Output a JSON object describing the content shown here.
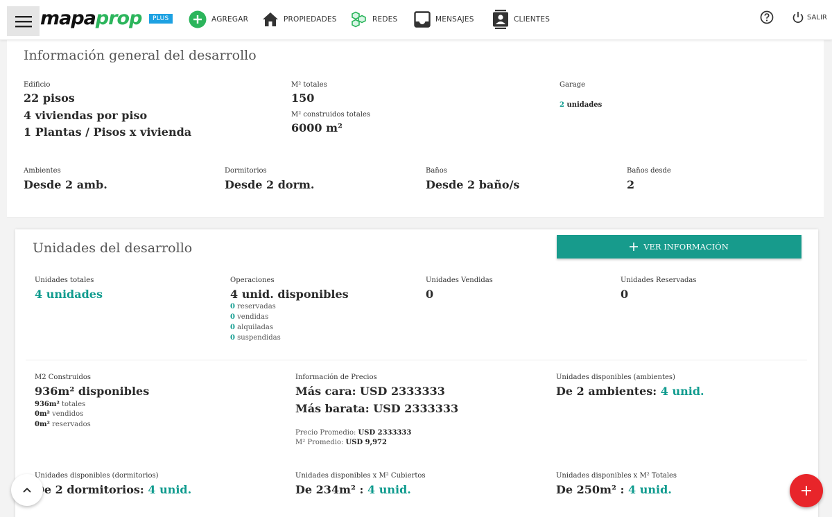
{
  "header": {
    "logo_a": "mapa",
    "logo_b": "prop",
    "plan_badge": "PLUS",
    "nav": [
      {
        "label": "AGREGAR",
        "icon": "add-circle-icon"
      },
      {
        "label": "PROPIEDADES",
        "icon": "home-icon"
      },
      {
        "label": "REDES",
        "icon": "network-icon"
      },
      {
        "label": "MENSAJES",
        "icon": "inbox-icon"
      },
      {
        "label": "CLIENTES",
        "icon": "contacts-icon"
      }
    ],
    "help_icon": "help-icon",
    "exit_label": "SALIR",
    "exit_icon": "power-icon"
  },
  "general": {
    "title": "Información general del desarrollo",
    "edificio_label": "Edificio",
    "edificio_lines": [
      "22 pisos",
      "4 viviendas por piso",
      "1 Plantas / Pisos x vivienda"
    ],
    "m2_totales_label": "M² totales",
    "m2_totales_value": "150",
    "m2_construidos_label": "M² construidos totales",
    "m2_construidos_value": "6000 m²",
    "garage_label": "Garage",
    "garage_count": "2",
    "garage_unit": "unidades",
    "ambientes_label": "Ambientes",
    "ambientes_value": "Desde 2 amb.",
    "dormitorios_label": "Dormitorios",
    "dormitorios_value": "Desde 2 dorm.",
    "banos_label": "Baños",
    "banos_value": "Desde 2 baño/s",
    "banos_desde_label": "Baños desde",
    "banos_desde_value": "2"
  },
  "units": {
    "title": "Unidades del desarrollo",
    "ver_button": "VER INFORMACIÓN",
    "totales_label": "Unidades totales",
    "totales_value": "4 unidades",
    "operaciones_label": "Operaciones",
    "operaciones_value": "4 unid. disponibles",
    "operaciones_breakdown": [
      {
        "count": "0",
        "label": "reservadas"
      },
      {
        "count": "0",
        "label": "vendidas"
      },
      {
        "count": "0",
        "label": "alquiladas"
      },
      {
        "count": "0",
        "label": "suspendidas"
      }
    ],
    "vendidas_label": "Unidades Vendidas",
    "vendidas_value": "0",
    "reservadas_label": "Unidades Reservadas",
    "reservadas_value": "0",
    "m2_label": "M2 Construidos",
    "m2_value": "936m² disponibles",
    "m2_totales": "936m²",
    "m2_totales_suffix": "totales",
    "m2_vendidos": "0m²",
    "m2_vendidos_suffix": "vendidos",
    "m2_reservados": "0m²",
    "m2_reservados_suffix": "reservados",
    "precios_label": "Información de Precios",
    "precio_cara": "Más cara: USD 2333333",
    "precio_barata": "Más barata: USD 2333333",
    "precio_promedio_label": "Precio Promedio:",
    "precio_promedio_value": "USD 2333333",
    "m2_promedio_label": "M² Promedio:",
    "m2_promedio_value": "USD 9,972",
    "disp_amb_label": "Unidades disponibles (ambientes)",
    "disp_amb_prefix": "De 2 ambientes:",
    "disp_amb_value": "4 unid.",
    "disp_dorm_label": "Unidades disponibles (dormitorios)",
    "disp_dorm_prefix": "De 2 dormitorios:",
    "disp_dorm_value": "4 unid.",
    "disp_cub_label": "Unidades disponibles x M² Cubiertos",
    "disp_cub_prefix": "De 234m² :",
    "disp_cub_value": "4 unid.",
    "disp_tot_label": "Unidades disponibles x M² Totales",
    "disp_tot_prefix": "De 250m² :",
    "disp_tot_value": "4 unid."
  },
  "colors": {
    "accent": "#0f9b8e",
    "button": "#179b8c",
    "fab": "#e8252a",
    "badge": "#1da1e2",
    "logo_green": "#2cb55c"
  }
}
